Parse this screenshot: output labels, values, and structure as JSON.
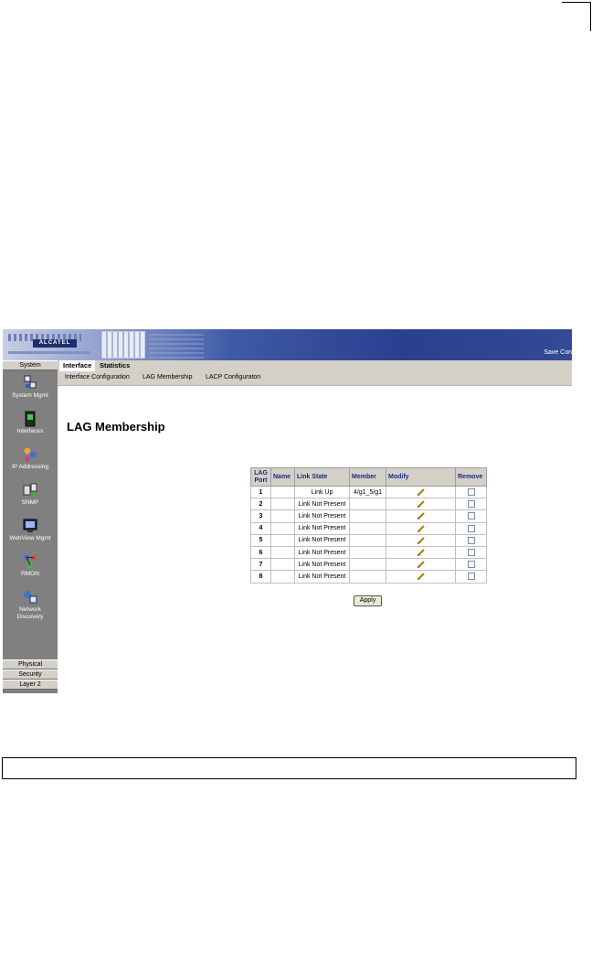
{
  "banner": {
    "logo_text": "ALCATEL",
    "save_config": "Save Con"
  },
  "leftnav": {
    "top_button": "System",
    "items": [
      {
        "label": "System Mgmt",
        "icon": "system-mgmt-icon"
      },
      {
        "label": "Interfaces",
        "icon": "interfaces-icon"
      },
      {
        "label": "IP Addressing",
        "icon": "ip-addressing-icon"
      },
      {
        "label": "SNMP",
        "icon": "snmp-icon"
      },
      {
        "label": "WebView Mgmt",
        "icon": "webview-mgmt-icon"
      },
      {
        "label": "RMON",
        "icon": "rmon-icon"
      },
      {
        "label": "Network Discovery",
        "icon": "network-discovery-icon"
      }
    ],
    "bottom_buttons": [
      "Physical",
      "Security",
      "Layer 2"
    ]
  },
  "tabs": [
    "Interface",
    "Statistics"
  ],
  "subtabs": [
    "Interface Configuration",
    "LAG Membership",
    "LACP Configuraton"
  ],
  "page_title": "LAG Membership",
  "table": {
    "headers": [
      "LAG Port",
      "Name",
      "Link State",
      "Member",
      "Modify",
      "Remove"
    ],
    "rows": [
      {
        "port": "1",
        "name": "",
        "state": "Link Up",
        "member": "4/g1_5/g1"
      },
      {
        "port": "2",
        "name": "",
        "state": "Link Not Present",
        "member": ""
      },
      {
        "port": "3",
        "name": "",
        "state": "Link Not Present",
        "member": ""
      },
      {
        "port": "4",
        "name": "",
        "state": "Link Not Present",
        "member": ""
      },
      {
        "port": "5",
        "name": "",
        "state": "Link Not Present",
        "member": ""
      },
      {
        "port": "6",
        "name": "",
        "state": "Link Not Present",
        "member": ""
      },
      {
        "port": "7",
        "name": "",
        "state": "Link Not Present",
        "member": ""
      },
      {
        "port": "8",
        "name": "",
        "state": "Link Not Present",
        "member": ""
      }
    ]
  },
  "apply_label": "Apply"
}
